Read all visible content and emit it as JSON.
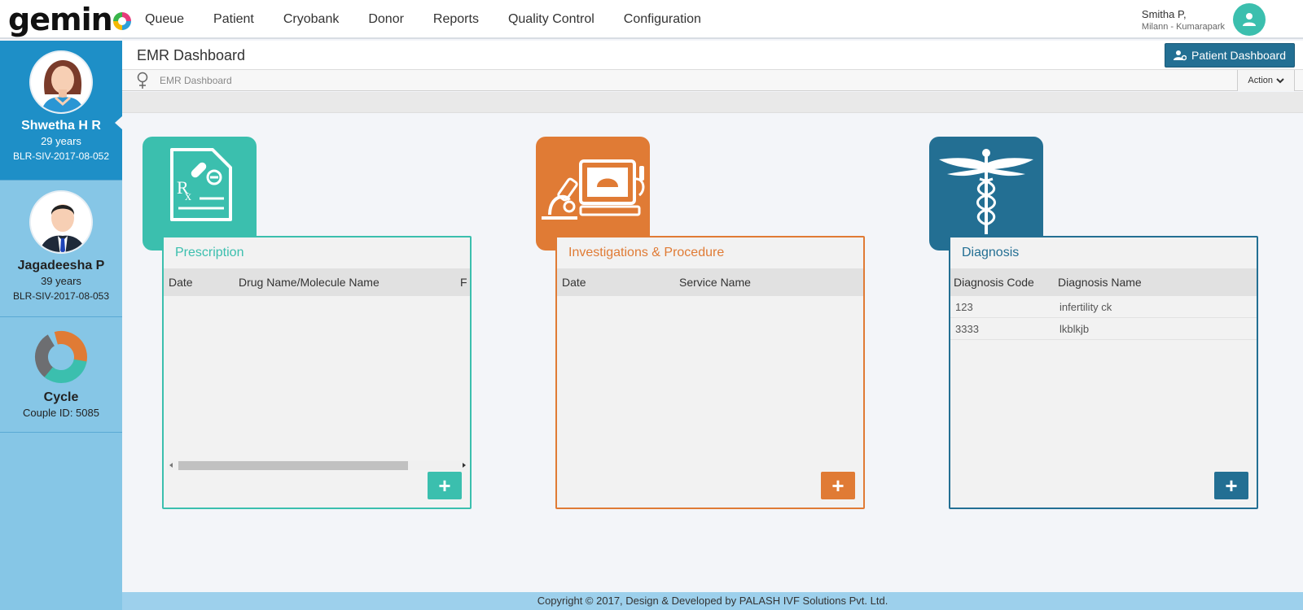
{
  "app": {
    "logo_text": "gemino"
  },
  "nav": {
    "items": [
      "Queue",
      "Patient",
      "Cryobank",
      "Donor",
      "Reports",
      "Quality Control",
      "Configuration"
    ]
  },
  "user": {
    "name": "Smitha P,",
    "location": "Milann - Kumarapark"
  },
  "sidebar": {
    "female": {
      "name": "Shwetha H R",
      "age": "29 years",
      "id": "BLR-SIV-2017-08-052"
    },
    "male": {
      "name": "Jagadeesha P",
      "age": "39 years",
      "id": "BLR-SIV-2017-08-053"
    },
    "cycle": {
      "label": "Cycle",
      "couple_id": "Couple ID: 5085"
    }
  },
  "page": {
    "title": "EMR Dashboard",
    "breadcrumb": "EMR Dashboard",
    "patient_dashboard_label": "Patient Dashboard",
    "action_label": "Action"
  },
  "prescription": {
    "title": "Prescription",
    "columns": [
      "Date",
      "Drug Name/Molecule Name",
      "F"
    ],
    "add_label": "+"
  },
  "investigations": {
    "title": "Investigations & Procedure",
    "columns": [
      "Date",
      "Service Name"
    ],
    "add_label": "+"
  },
  "diagnosis": {
    "title": "Diagnosis",
    "columns": [
      "Diagnosis Code",
      "Diagnosis Name"
    ],
    "rows": [
      {
        "code": "123",
        "name": "infertility ck"
      },
      {
        "code": "3333",
        "name": "lkblkjb"
      }
    ],
    "add_label": "+"
  },
  "footer": {
    "text": "Copyright © 2017, Design & Developed by PALASH IVF Solutions Pvt. Ltd."
  },
  "colors": {
    "teal": "#3bbfae",
    "orange": "#e07b35",
    "blue": "#236f93",
    "sidebar_active": "#1e8fc7",
    "sidebar": "#86c6e6"
  }
}
